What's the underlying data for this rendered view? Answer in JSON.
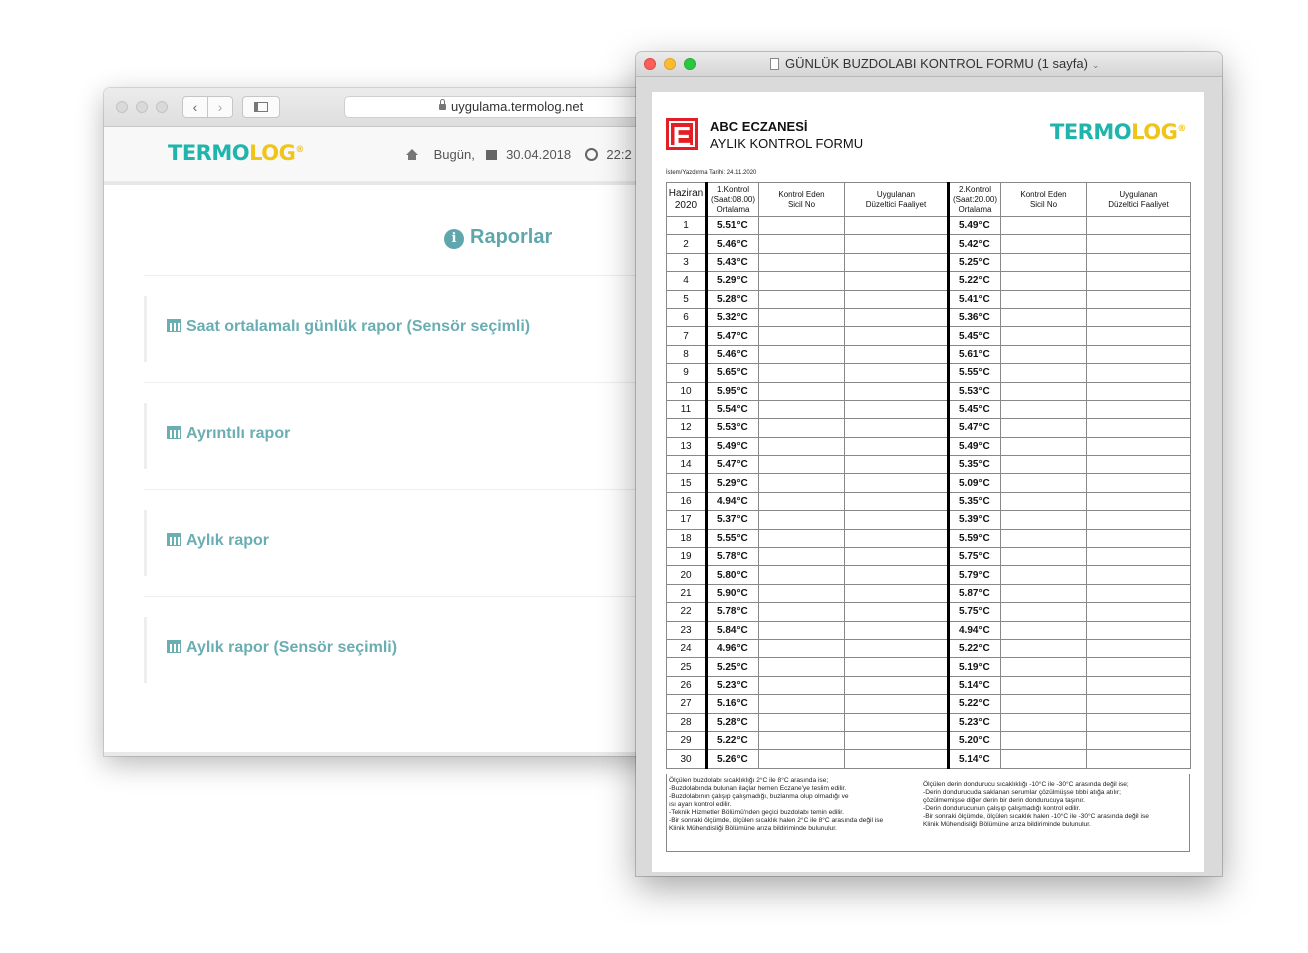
{
  "browser": {
    "url": "uygulama.termolog.net",
    "logo": {
      "part1": "TERMO",
      "part2": "LOG",
      "mark": "®"
    },
    "header": {
      "today_label": "Bugün,",
      "date": "30.04.2018",
      "time_partial": "22:2"
    },
    "reports_title": "Raporlar",
    "reports": [
      {
        "label": "Saat ortalamalı günlük rapor (Sensör seçimli)"
      },
      {
        "label": "Ayrıntılı rapor"
      },
      {
        "label": "Aylık rapor"
      },
      {
        "label": "Aylık rapor (Sensör seçimli)"
      }
    ]
  },
  "viewer": {
    "title": "GÜNLÜK BUZDOLABI KONTROL FORMU (1 sayfa)",
    "pharmacy": "ABC ECZANESİ",
    "form_name": "AYLIK KONTROL FORMU",
    "pharmacy_badge": "E",
    "print_date": "İstem/Yazdırma Tarihi: 24.11.2020",
    "columns": {
      "month": "Haziran",
      "year": "2020",
      "c1_line1": "1.Kontrol",
      "c1_line2": "(Saat:08.00)",
      "c1_line3": "Ortalama",
      "inspector_line1": "Kontrol Eden",
      "inspector_line2": "Sicil No",
      "action_line1": "Uygulanan",
      "action_line2": "Düzeltici Faaliyet",
      "c2_line1": "2.Kontrol",
      "c2_line2": "(Saat:20.00)",
      "c2_line3": "Ortalama"
    },
    "rows": [
      {
        "day": "1",
        "t1": "5.51°C",
        "t2": "5.49°C"
      },
      {
        "day": "2",
        "t1": "5.46°C",
        "t2": "5.42°C"
      },
      {
        "day": "3",
        "t1": "5.43°C",
        "t2": "5.25°C"
      },
      {
        "day": "4",
        "t1": "5.29°C",
        "t2": "5.22°C"
      },
      {
        "day": "5",
        "t1": "5.28°C",
        "t2": "5.41°C"
      },
      {
        "day": "6",
        "t1": "5.32°C",
        "t2": "5.36°C"
      },
      {
        "day": "7",
        "t1": "5.47°C",
        "t2": "5.45°C"
      },
      {
        "day": "8",
        "t1": "5.46°C",
        "t2": "5.61°C"
      },
      {
        "day": "9",
        "t1": "5.65°C",
        "t2": "5.55°C"
      },
      {
        "day": "10",
        "t1": "5.95°C",
        "t2": "5.53°C"
      },
      {
        "day": "11",
        "t1": "5.54°C",
        "t2": "5.45°C"
      },
      {
        "day": "12",
        "t1": "5.53°C",
        "t2": "5.47°C"
      },
      {
        "day": "13",
        "t1": "5.49°C",
        "t2": "5.49°C"
      },
      {
        "day": "14",
        "t1": "5.47°C",
        "t2": "5.35°C"
      },
      {
        "day": "15",
        "t1": "5.29°C",
        "t2": "5.09°C"
      },
      {
        "day": "16",
        "t1": "4.94°C",
        "t2": "5.35°C"
      },
      {
        "day": "17",
        "t1": "5.37°C",
        "t2": "5.39°C"
      },
      {
        "day": "18",
        "t1": "5.55°C",
        "t2": "5.59°C"
      },
      {
        "day": "19",
        "t1": "5.78°C",
        "t2": "5.75°C"
      },
      {
        "day": "20",
        "t1": "5.80°C",
        "t2": "5.79°C"
      },
      {
        "day": "21",
        "t1": "5.90°C",
        "t2": "5.87°C"
      },
      {
        "day": "22",
        "t1": "5.78°C",
        "t2": "5.75°C"
      },
      {
        "day": "23",
        "t1": "5.84°C",
        "t2": "4.94°C"
      },
      {
        "day": "24",
        "t1": "4.96°C",
        "t2": "5.22°C"
      },
      {
        "day": "25",
        "t1": "5.25°C",
        "t2": "5.19°C"
      },
      {
        "day": "26",
        "t1": "5.23°C",
        "t2": "5.14°C"
      },
      {
        "day": "27",
        "t1": "5.16°C",
        "t2": "5.22°C"
      },
      {
        "day": "28",
        "t1": "5.28°C",
        "t2": "5.23°C"
      },
      {
        "day": "29",
        "t1": "5.22°C",
        "t2": "5.20°C"
      },
      {
        "day": "30",
        "t1": "5.26°C",
        "t2": "5.14°C"
      }
    ],
    "note_left": "Ölçülen buzdolabı sıcaklıklığı 2°C ile 8°C arasında ise;\n-Buzdolabında bulunan ilaçlar hemen Eczane'ye teslim edilir.\n-Buzdolabının çalışıp çalışmadığı, buzlanma olup olmadığı ve\nısı ayarı kontrol edilir.\n-Teknik Hizmetler Bölümü'nden geçici buzdolabı temin edilir.\n-Bir sonraki ölçümde, ölçülen sıcaklık halen 2°C ile 8°C arasında değil ise\nKlinik Mühendisliği Bölümüne arıza bildiriminde bulunulur.",
    "note_right": "Ölçülen derin dondurucu sıcaklıklığı -10°C ile -30°C arasında değil ise;\n-Derin dondurucuda saklanan serumlar çözülmüşse tıbbi atığa atılır;\nçözülmemişse diğer derin bir derin dondurucuya taşınır.\n-Derin dondurucunun çalışıp çalışmadığı kontrol edilir.\n-Bir sonraki ölçümde, ölçülen sıcaklık halen -10°C ile -30°C arasında değil ise\nKlinik Mühendisliği Bölümüne arıza bildiriminde bulunulur."
  }
}
